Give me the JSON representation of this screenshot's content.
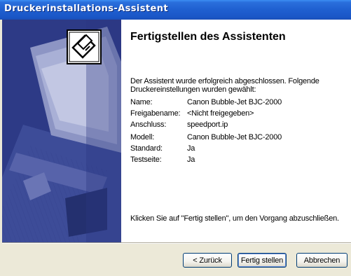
{
  "window": {
    "title": "Druckerinstallations-Assistent"
  },
  "content": {
    "heading": "Fertigstellen des Assistenten",
    "intro": "Der Assistent wurde erfolgreich abgeschlossen. Folgende Druckereinstellungen wurden gewählt:",
    "settings": [
      {
        "label": "Name:",
        "value": "Canon Bubble-Jet BJC-2000"
      },
      {
        "label": "Freigabename:",
        "value": "<Nicht freigegeben>"
      },
      {
        "label": "Anschluss:",
        "value": "speedport.ip"
      },
      {
        "label": "Modell:",
        "value": "Canon Bubble-Jet BJC-2000"
      },
      {
        "label": "Standard:",
        "value": "Ja"
      },
      {
        "label": "Testseite:",
        "value": "Ja"
      }
    ],
    "finish_hint": "Klicken Sie auf \"Fertig stellen\", um den Vorgang abzuschließen."
  },
  "buttons": {
    "back": "< Zurück",
    "finish": "Fertig stellen",
    "cancel": "Abbrechen"
  },
  "icons": {
    "printer": "printer-icon"
  },
  "colors": {
    "titlebar": "#1f5fd0",
    "side_panel": "#2f3d88",
    "dialog_bg": "#ece9d8"
  }
}
